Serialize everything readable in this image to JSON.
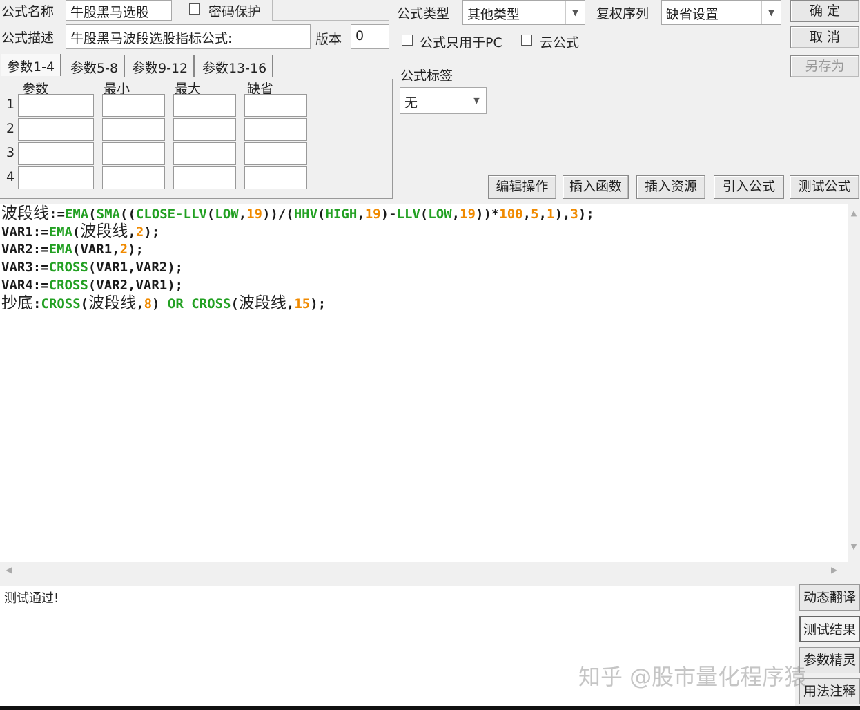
{
  "form": {
    "name_label": "公式名称",
    "name_value": "牛股黑马选股",
    "password_label": "密码保护",
    "desc_label": "公式描述",
    "desc_value": "牛股黑马波段选股指标公式:",
    "version_label": "版本",
    "version_value": "0",
    "type_label": "公式类型",
    "type_value": "其他类型",
    "fq_label": "复权序列",
    "fq_value": "缺省设置",
    "pc_only_label": "公式只用于PC",
    "cloud_label": "云公式",
    "tag_label": "公式标签",
    "tag_value": "无"
  },
  "buttons": {
    "ok": "确 定",
    "cancel": "取 消",
    "save_as": "另存为"
  },
  "tabs": [
    "参数1-4",
    "参数5-8",
    "参数9-12",
    "参数13-16"
  ],
  "param_headers": [
    "参数",
    "最小",
    "最大",
    "缺省"
  ],
  "param_rows": [
    "1",
    "2",
    "3",
    "4"
  ],
  "toolbar": [
    "编辑操作",
    "插入函数",
    "插入资源",
    "引入公式",
    "测试公式"
  ],
  "code": [
    [
      [
        "波段线",
        "cn"
      ],
      [
        ":=",
        "id"
      ],
      [
        "EMA",
        "fn"
      ],
      [
        "(",
        "id"
      ],
      [
        "SMA",
        "fn"
      ],
      [
        "((",
        "id"
      ],
      [
        "CLOSE-LLV",
        "fn"
      ],
      [
        "(",
        "id"
      ],
      [
        "LOW",
        "fn"
      ],
      [
        ",",
        "id"
      ],
      [
        "19",
        "num"
      ],
      [
        "))/(",
        "id"
      ],
      [
        "HHV",
        "fn"
      ],
      [
        "(",
        "id"
      ],
      [
        "HIGH",
        "fn"
      ],
      [
        ",",
        "id"
      ],
      [
        "19",
        "num"
      ],
      [
        ")-",
        "id"
      ],
      [
        "LLV",
        "fn"
      ],
      [
        "(",
        "id"
      ],
      [
        "LOW",
        "fn"
      ],
      [
        ",",
        "id"
      ],
      [
        "19",
        "num"
      ],
      [
        "))*",
        "id"
      ],
      [
        "100",
        "num"
      ],
      [
        ",",
        "id"
      ],
      [
        "5",
        "num"
      ],
      [
        ",",
        "id"
      ],
      [
        "1",
        "num"
      ],
      [
        "),",
        "id"
      ],
      [
        "3",
        "num"
      ],
      [
        ");",
        "id"
      ]
    ],
    [
      [
        "VAR1:=",
        "id"
      ],
      [
        "EMA",
        "fn"
      ],
      [
        "(",
        "id"
      ],
      [
        "波段线",
        "cn"
      ],
      [
        ",",
        "id"
      ],
      [
        "2",
        "num"
      ],
      [
        ");",
        "id"
      ]
    ],
    [
      [
        "VAR2:=",
        "id"
      ],
      [
        "EMA",
        "fn"
      ],
      [
        "(VAR1,",
        "id"
      ],
      [
        "2",
        "num"
      ],
      [
        ");",
        "id"
      ]
    ],
    [
      [
        "VAR3:=",
        "id"
      ],
      [
        "CROSS",
        "fn"
      ],
      [
        "(VAR1,VAR2);",
        "id"
      ]
    ],
    [
      [
        "VAR4:=",
        "id"
      ],
      [
        "CROSS",
        "fn"
      ],
      [
        "(VAR2,VAR1);",
        "id"
      ]
    ],
    [
      [
        "抄底",
        "cn"
      ],
      [
        ":",
        "id"
      ],
      [
        "CROSS",
        "fn"
      ],
      [
        "(",
        "id"
      ],
      [
        "波段线",
        "cn"
      ],
      [
        ",",
        "id"
      ],
      [
        "8",
        "num"
      ],
      [
        ") ",
        "id"
      ],
      [
        "OR",
        "fn"
      ],
      [
        " ",
        "id"
      ],
      [
        "CROSS",
        "fn"
      ],
      [
        "(",
        "id"
      ],
      [
        "波段线",
        "cn"
      ],
      [
        ",",
        "id"
      ],
      [
        "15",
        "num"
      ],
      [
        ");",
        "id"
      ]
    ]
  ],
  "output_text": "测试通过!",
  "side_buttons": [
    "动态翻译",
    "测试结果",
    "参数精灵",
    "用法注释"
  ],
  "watermark": "知乎 @股市量化程序猿"
}
